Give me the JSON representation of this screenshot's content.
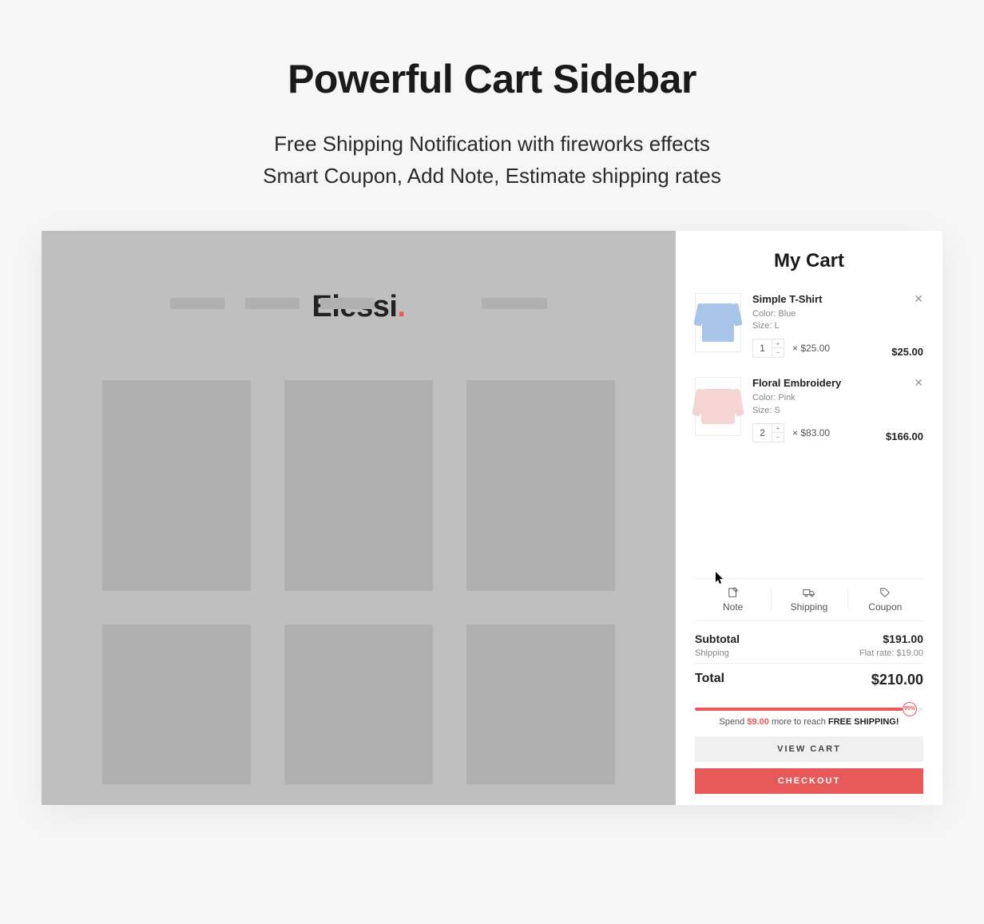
{
  "hero": {
    "title": "Powerful Cart Sidebar",
    "line1": "Free Shipping Notification with fireworks effects",
    "line2": "Smart Coupon, Add Note, Estimate shipping rates"
  },
  "brand": {
    "name": "Elessi",
    "accent_color": "#e85a5a"
  },
  "cart": {
    "title": "My Cart",
    "items": [
      {
        "name": "Simple T-Shirt",
        "color_label": "Color:",
        "color_value": "Blue",
        "size_label": "Size:",
        "size_value": "L",
        "qty": "1",
        "unit_prefix": "×",
        "unit_price": "$25.00",
        "line_total": "$25.00"
      },
      {
        "name": "Floral Embroidery",
        "color_label": "Color:",
        "color_value": "Pink",
        "size_label": "Size:",
        "size_value": "S",
        "qty": "2",
        "unit_prefix": "×",
        "unit_price": "$83.00",
        "line_total": "$166.00"
      }
    ],
    "actions": {
      "note": "Note",
      "shipping": "Shipping",
      "coupon": "Coupon"
    },
    "totals": {
      "subtotal_label": "Subtotal",
      "subtotal_value": "$191.00",
      "shipping_label": "Shipping",
      "shipping_value": "Flat rate: $19.00",
      "total_label": "Total",
      "total_value": "$210.00"
    },
    "free_shipping": {
      "percent_label": "95%",
      "msg_prefix": "Spend ",
      "msg_amount": "$9.00",
      "msg_mid": " more to reach ",
      "msg_suffix": "FREE SHIPPING!"
    },
    "buttons": {
      "view_cart": "VIEW CART",
      "checkout": "CHECKOUT"
    }
  }
}
